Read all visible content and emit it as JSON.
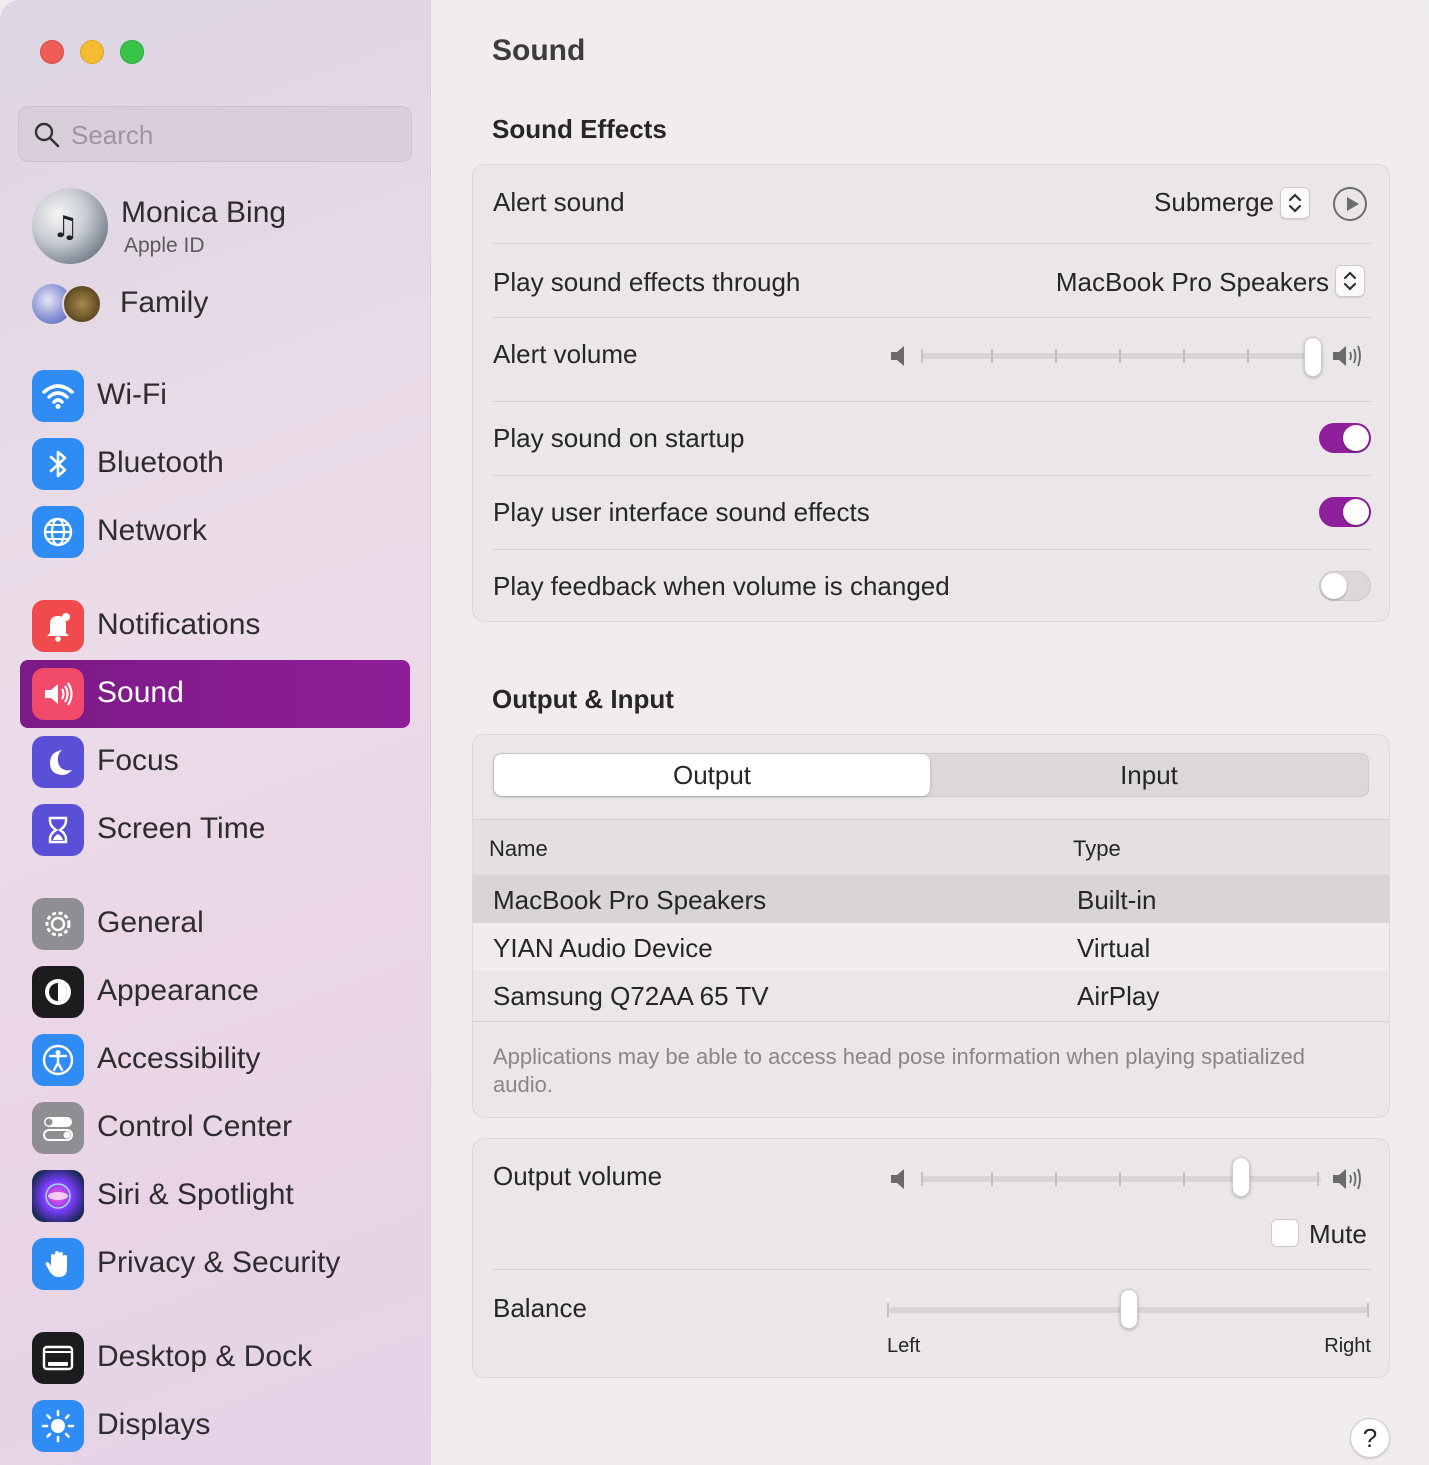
{
  "window": {
    "controls": [
      "close",
      "minimize",
      "zoom"
    ]
  },
  "sidebar": {
    "search": {
      "placeholder": "Search",
      "icon": "search-icon"
    },
    "profile": {
      "name": "Monica Bing",
      "subtitle": "Apple ID"
    },
    "family": {
      "label": "Family"
    },
    "items": [
      {
        "key": "wifi",
        "label": "Wi-Fi",
        "icon": "wifi-icon",
        "color": "#2f8cf4"
      },
      {
        "key": "bluetooth",
        "label": "Bluetooth",
        "icon": "bluetooth-icon",
        "color": "#2f8cf4"
      },
      {
        "key": "network",
        "label": "Network",
        "icon": "globe-icon",
        "color": "#2f8cf4"
      },
      {
        "key": "notifications",
        "label": "Notifications",
        "icon": "bell-icon",
        "color": "#f14a4c"
      },
      {
        "key": "sound",
        "label": "Sound",
        "icon": "speaker-icon",
        "color": "#f14a6a",
        "active": true
      },
      {
        "key": "focus",
        "label": "Focus",
        "icon": "moon-icon",
        "color": "#5b4fd8"
      },
      {
        "key": "screen-time",
        "label": "Screen Time",
        "icon": "hourglass-icon",
        "color": "#5b4fd8"
      },
      {
        "key": "general",
        "label": "General",
        "icon": "gear-icon",
        "color": "#8e8e93"
      },
      {
        "key": "appearance",
        "label": "Appearance",
        "icon": "appearance-icon",
        "color": "#1c1c1e"
      },
      {
        "key": "accessibility",
        "label": "Accessibility",
        "icon": "accessibility-icon",
        "color": "#2f8cf4"
      },
      {
        "key": "control-center",
        "label": "Control Center",
        "icon": "toggles-icon",
        "color": "#8e8e93"
      },
      {
        "key": "siri",
        "label": "Siri & Spotlight",
        "icon": "siri-icon",
        "color": "#3a2a6b"
      },
      {
        "key": "privacy",
        "label": "Privacy & Security",
        "icon": "hand-icon",
        "color": "#2f8cf4"
      },
      {
        "key": "desktop-dock",
        "label": "Desktop & Dock",
        "icon": "dock-icon",
        "color": "#1c1c1e"
      },
      {
        "key": "displays",
        "label": "Displays",
        "icon": "sun-icon",
        "color": "#2f8cf4"
      }
    ]
  },
  "main": {
    "title": "Sound",
    "sound_effects": {
      "heading": "Sound Effects",
      "alert_sound": {
        "label": "Alert sound",
        "value": "Submerge"
      },
      "play_through": {
        "label": "Play sound effects through",
        "value": "MacBook Pro Speakers"
      },
      "alert_volume": {
        "label": "Alert volume",
        "level": 1.0
      },
      "startup": {
        "label": "Play sound on startup",
        "on": true
      },
      "ui_sounds": {
        "label": "Play user interface sound effects",
        "on": true
      },
      "feedback": {
        "label": "Play feedback when volume is changed",
        "on": false
      }
    },
    "output_input": {
      "heading": "Output & Input",
      "tabs": [
        "Output",
        "Input"
      ],
      "selected_tab": "Output",
      "columns": [
        "Name",
        "Type"
      ],
      "devices": [
        {
          "name": "MacBook Pro Speakers",
          "type": "Built-in",
          "selected": true
        },
        {
          "name": "YIAN Audio Device",
          "type": "Virtual"
        },
        {
          "name": "Samsung Q72AA 65 TV",
          "type": "AirPlay"
        }
      ],
      "note": "Applications may be able to access head pose information when playing spatialized audio."
    },
    "output_volume": {
      "label": "Output volume",
      "level": 0.8,
      "mute_label": "Mute",
      "muted": false
    },
    "balance": {
      "label": "Balance",
      "left_label": "Left",
      "right_label": "Right",
      "level": 0.5
    },
    "help_label": "?",
    "accent_color": "#8f1f9b"
  }
}
